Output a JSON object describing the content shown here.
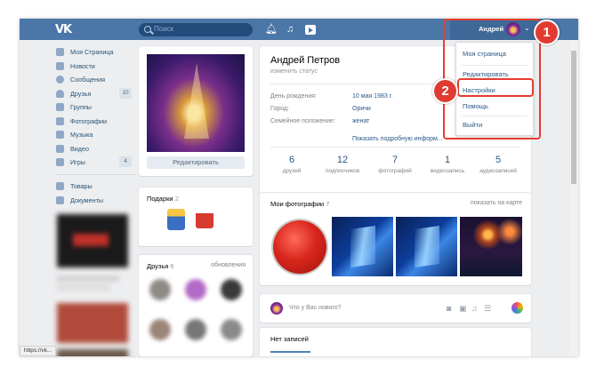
{
  "topbar": {
    "search_placeholder": "Поиск",
    "user_name": "Андрей"
  },
  "dropdown": {
    "items": [
      "Моя страница",
      "Редактировать",
      "Настройки",
      "Помощь",
      "Выйти"
    ]
  },
  "callouts": [
    "1",
    "2"
  ],
  "sidebar": {
    "items": [
      {
        "label": "Моя Страница",
        "icon": "home-icon"
      },
      {
        "label": "Новости",
        "icon": "news-icon"
      },
      {
        "label": "Сообщения",
        "icon": "messages-icon"
      },
      {
        "label": "Друзья",
        "icon": "friends-icon",
        "count": "10"
      },
      {
        "label": "Группы",
        "icon": "groups-icon"
      },
      {
        "label": "Фотографии",
        "icon": "camera-icon"
      },
      {
        "label": "Музыка",
        "icon": "music-icon"
      },
      {
        "label": "Видео",
        "icon": "video-icon"
      },
      {
        "label": "Игры",
        "icon": "games-icon",
        "count": "4"
      }
    ],
    "extra": [
      {
        "label": "Товары",
        "icon": "goods-icon"
      },
      {
        "label": "Документы",
        "icon": "documents-icon"
      }
    ]
  },
  "left": {
    "edit_button": "Редактировать",
    "gifts_title": "Подарки",
    "gifts_count": "2",
    "friends_title": "Друзья",
    "friends_count": "6",
    "friends_link": "обновления"
  },
  "profile": {
    "name": "Андрей Петров",
    "status": "изменить статус",
    "info": [
      {
        "key": "День рождения:",
        "value": "10 мая 1983 г."
      },
      {
        "key": "Город:",
        "value": "Оричи"
      },
      {
        "key": "Семейное положение:",
        "value": "женат"
      }
    ],
    "more_link": "Показать подробную информ...",
    "stats": [
      {
        "n": "6",
        "label": "друзей"
      },
      {
        "n": "12",
        "label": "подписчиков"
      },
      {
        "n": "7",
        "label": "фотографий"
      },
      {
        "n": "1",
        "label": "видеозапись"
      },
      {
        "n": "5",
        "label": "аудиозаписей"
      }
    ]
  },
  "photos": {
    "title": "Мои фотографии",
    "count": "7",
    "map_link": "показать на карте"
  },
  "post": {
    "placeholder": "Что у Вас нового?"
  },
  "wall": {
    "title": "Нет записей"
  },
  "status_url": "https://vk..."
}
